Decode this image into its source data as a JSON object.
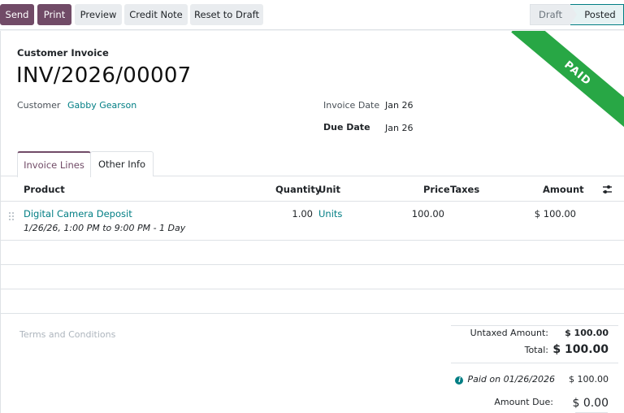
{
  "toolbar": {
    "send": "Send",
    "print": "Print",
    "preview": "Preview",
    "credit_note": "Credit Note",
    "reset_to_draft": "Reset to Draft"
  },
  "status": {
    "draft": "Draft",
    "posted": "Posted",
    "active": "Posted"
  },
  "ribbon": "PAID",
  "invoice": {
    "type": "Customer Invoice",
    "number": "INV/2026/00007",
    "customer_label": "Customer",
    "customer": "Gabby Gearson",
    "invoice_date_label": "Invoice Date",
    "invoice_date": "Jan 26",
    "due_date_label": "Due Date",
    "due_date": "Jan 26"
  },
  "tabs": {
    "invoice_lines": "Invoice Lines",
    "other_info": "Other Info"
  },
  "table": {
    "headers": {
      "product": "Product",
      "quantity": "Quantity",
      "unit": "Unit",
      "price": "Price",
      "taxes": "Taxes",
      "amount": "Amount"
    },
    "rows": [
      {
        "product": "Digital Camera Deposit",
        "description": "1/26/26, 1:00 PM to 9:00 PM - 1 Day",
        "quantity": "1.00",
        "unit": "Units",
        "price": "100.00",
        "taxes": "",
        "amount": "$ 100.00"
      }
    ]
  },
  "terms_placeholder": "Terms and Conditions",
  "totals": {
    "untaxed_label": "Untaxed Amount:",
    "untaxed": "$ 100.00",
    "total_label": "Total:",
    "total": "$ 100.00",
    "paid_label": "Paid on 01/26/2026",
    "paid": "$ 100.00",
    "due_label": "Amount Due:",
    "due": "$ 0.00"
  },
  "colors": {
    "brand": "#714b67",
    "link": "#017e84",
    "paid_ribbon": "#28a745"
  }
}
